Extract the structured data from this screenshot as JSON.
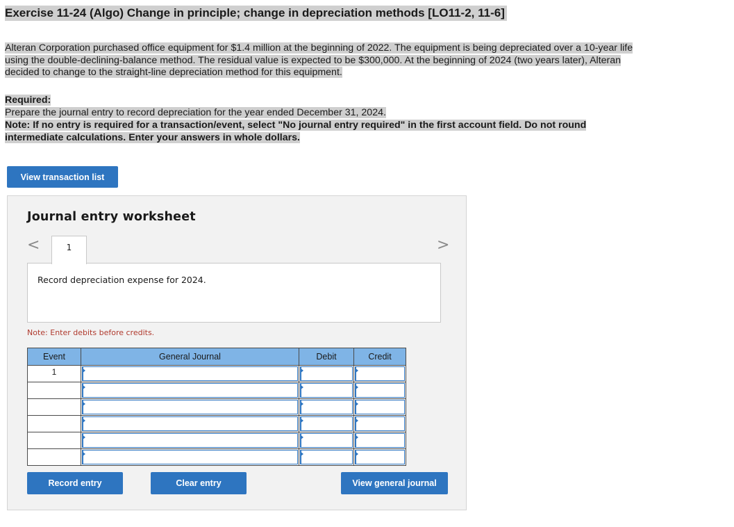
{
  "header": {
    "title": "Exercise 11-24 (Algo) Change in principle; change in depreciation methods [LO11-2, 11-6]"
  },
  "problem": {
    "intro": "Alteran Corporation purchased office equipment for $1.4 million at the beginning of 2022. The equipment is being depreciated over a 10-year life using the double-declining-balance method. The residual value is expected to be $300,000. At the beginning of 2024 (two years later), Alteran decided to change to the straight-line depreciation method for this equipment.",
    "required_label": "Required:",
    "required_text": "Prepare the journal entry to record depreciation for the year ended December 31, 2024.",
    "note": "Note: If no entry is required for a transaction/event, select \"No journal entry required\" in the first account field. Do not round intermediate calculations. Enter your answers in whole dollars."
  },
  "buttons": {
    "view_transactions": "View transaction list",
    "record_entry": "Record entry",
    "clear_entry": "Clear entry",
    "view_general_journal": "View general journal"
  },
  "worksheet": {
    "title": "Journal entry worksheet",
    "prev_icon": "<",
    "next_icon": ">",
    "tabs": [
      {
        "label": "1"
      }
    ],
    "instruction": "Record depreciation expense for 2024.",
    "note": "Note: Enter debits before credits."
  },
  "table": {
    "headers": {
      "event": "Event",
      "general_journal": "General Journal",
      "debit": "Debit",
      "credit": "Credit"
    },
    "rows": [
      {
        "event": "1",
        "account": "",
        "debit": "",
        "credit": ""
      },
      {
        "event": "",
        "account": "",
        "debit": "",
        "credit": ""
      },
      {
        "event": "",
        "account": "",
        "debit": "",
        "credit": ""
      },
      {
        "event": "",
        "account": "",
        "debit": "",
        "credit": ""
      },
      {
        "event": "",
        "account": "",
        "debit": "",
        "credit": ""
      },
      {
        "event": "",
        "account": "",
        "debit": "",
        "credit": ""
      }
    ]
  },
  "colors": {
    "button_blue": "#2e75c0",
    "table_header_blue": "#7fb4e6",
    "highlight_gray": "#cfcfcf",
    "note_red": "#b03a2e",
    "worksheet_bg": "#f2f2f2"
  }
}
